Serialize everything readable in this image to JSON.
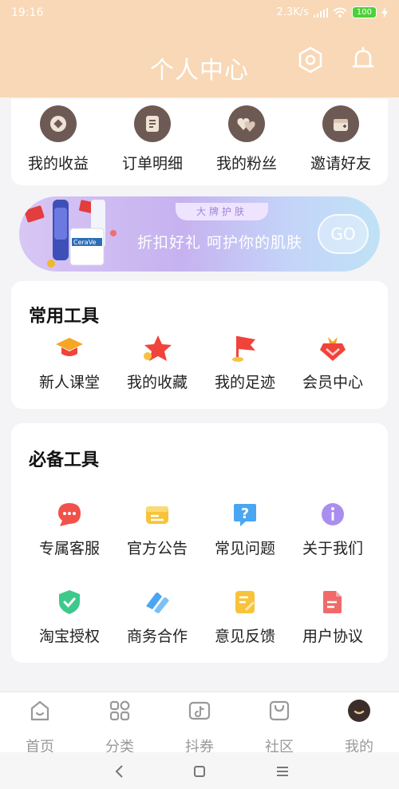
{
  "status": {
    "time": "19:16",
    "network_speed": "2.3K/s",
    "battery": "100"
  },
  "header": {
    "title": "个人中心",
    "settings_icon": "hexagon-settings-icon",
    "notification_icon": "bell-icon"
  },
  "top_menu": [
    {
      "label": "我的收益",
      "icon": "coin-icon"
    },
    {
      "label": "订单明细",
      "icon": "document-icon"
    },
    {
      "label": "我的粉丝",
      "icon": "hearts-icon"
    },
    {
      "label": "邀请好友",
      "icon": "gift-icon"
    }
  ],
  "banner": {
    "tag": "大牌护肤",
    "slogan": "折扣好礼 呵护你的肌肤",
    "button": "GO",
    "product_brand": "CeraVe"
  },
  "common_tools": {
    "title": "常用工具",
    "items": [
      {
        "label": "新人课堂",
        "icon": "graduation-cap-icon",
        "color": "#f5a623"
      },
      {
        "label": "我的收藏",
        "icon": "star-icon",
        "color": "#f0433c"
      },
      {
        "label": "我的足迹",
        "icon": "flag-icon",
        "color": "#f0433c"
      },
      {
        "label": "会员中心",
        "icon": "crown-diamond-icon",
        "color": "#f0433c"
      }
    ]
  },
  "essential_tools": {
    "title": "必备工具",
    "items": [
      {
        "label": "专属客服",
        "icon": "chat-bubble-icon",
        "color": "#f0524a"
      },
      {
        "label": "官方公告",
        "icon": "notice-icon",
        "color": "#f8c23a"
      },
      {
        "label": "常见问题",
        "icon": "question-icon",
        "color": "#4aa6f2"
      },
      {
        "label": "关于我们",
        "icon": "info-icon",
        "color": "#a98ef0"
      },
      {
        "label": "淘宝授权",
        "icon": "shield-check-icon",
        "color": "#3ec98c"
      },
      {
        "label": "商务合作",
        "icon": "handshake-icon",
        "color": "#4aa6f2"
      },
      {
        "label": "意见反馈",
        "icon": "feedback-icon",
        "color": "#f8c23a"
      },
      {
        "label": "用户协议",
        "icon": "agreement-icon",
        "color": "#f06a6a"
      }
    ]
  },
  "tabbar": [
    {
      "label": "首页",
      "icon": "home-icon"
    },
    {
      "label": "分类",
      "icon": "category-icon"
    },
    {
      "label": "抖券",
      "icon": "douyin-coupon-icon"
    },
    {
      "label": "社区",
      "icon": "community-bag-icon"
    },
    {
      "label": "我的",
      "icon": "profile-avatar-icon",
      "active": true
    }
  ]
}
